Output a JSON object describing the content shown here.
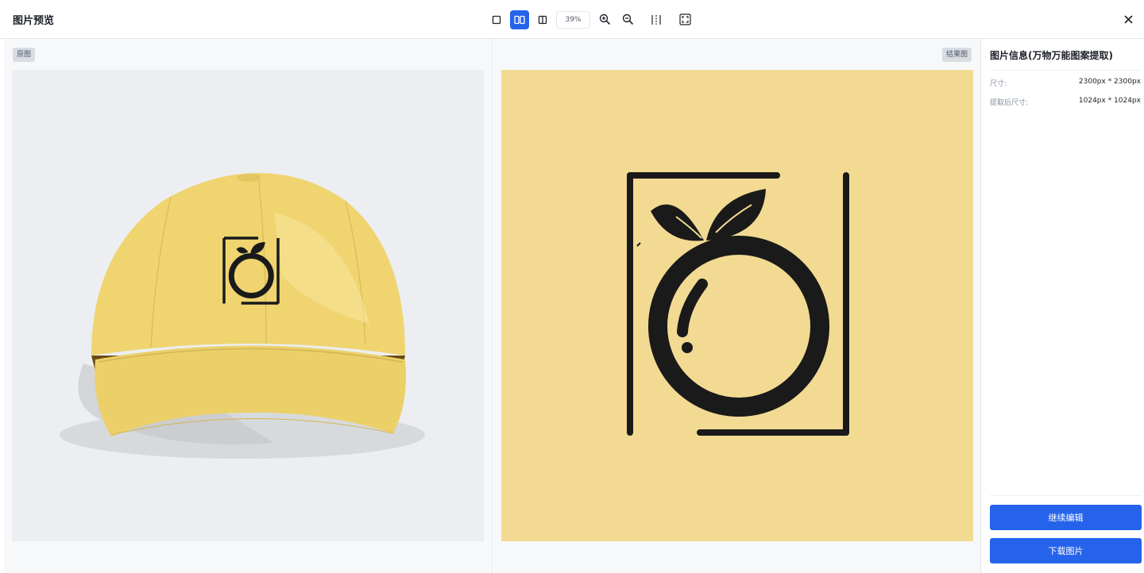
{
  "header": {
    "title": "图片预览",
    "zoom": "39%",
    "toolbar_icons": [
      "single-view-icon",
      "dual-view-icon",
      "compare-view-icon",
      "zoom-in-icon",
      "zoom-out-icon",
      "split-icon",
      "fullscreen-icon"
    ],
    "active_view": "dual-view-icon"
  },
  "left_panel": {
    "tag": "原图"
  },
  "right_panel": {
    "tag": "结果图"
  },
  "sidebar": {
    "title": "图片信息(万物万能图案提取)",
    "rows": [
      {
        "key": "尺寸:",
        "value": "2300px * 2300px"
      },
      {
        "key": "提取后尺寸:",
        "value": "1024px * 1024px"
      }
    ],
    "continue_edit": "继续编辑",
    "download": "下载图片"
  },
  "colors": {
    "accent": "#2563eb",
    "cap_yellow": "#f0d872",
    "result_bg": "#f3da92",
    "logo_black": "#1a1a1a"
  }
}
